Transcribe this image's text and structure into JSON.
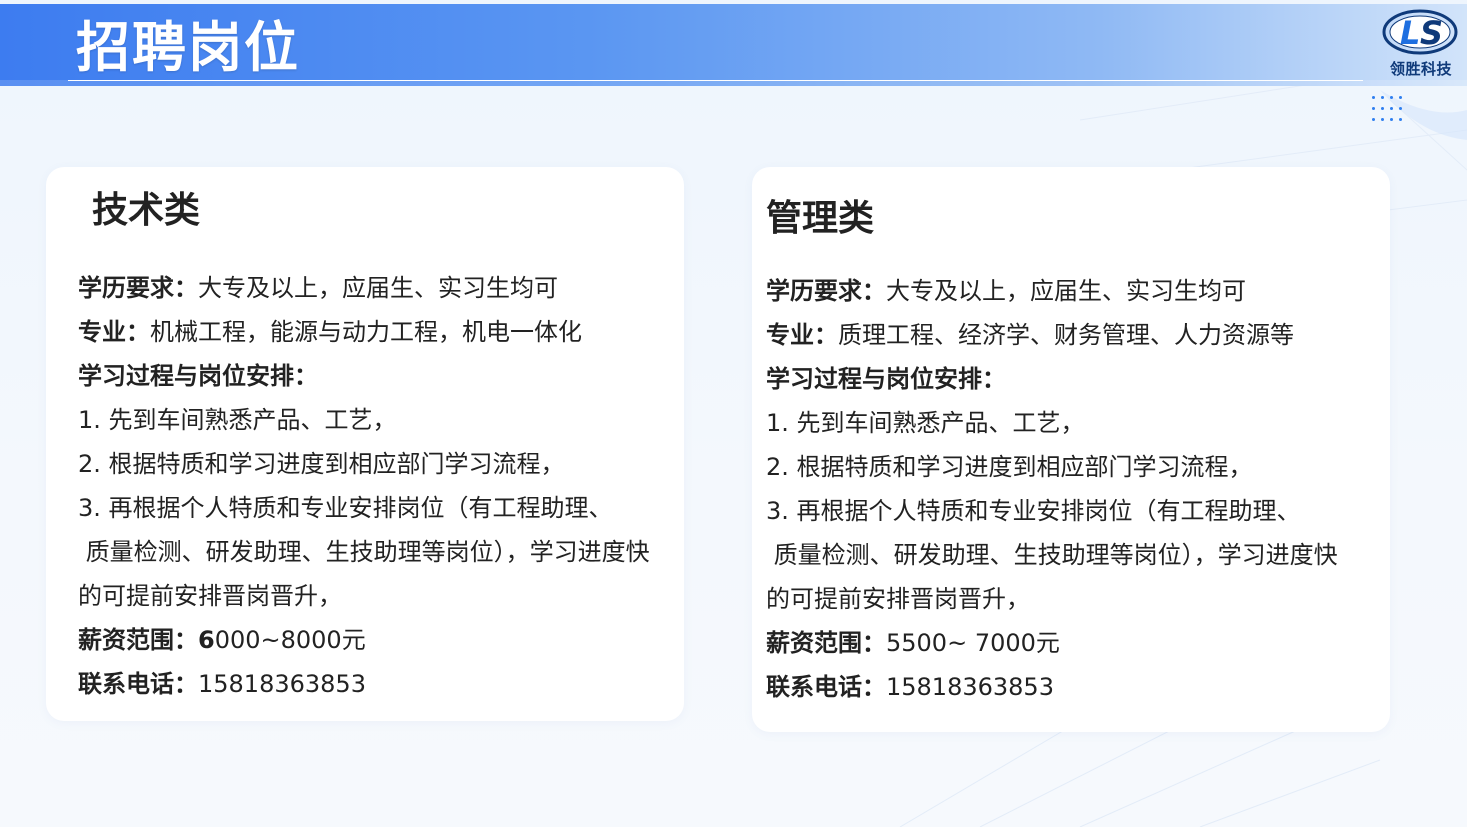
{
  "header": {
    "title": "招聘岗位",
    "logo_text": "领胜科技",
    "logo_icon": "ls-logo-icon"
  },
  "cards": [
    {
      "title": "技术类",
      "education_label": "学历要求：",
      "education_value": "大专及以上，应届生、实习生均可",
      "major_label": "专业：",
      "major_value": "机械工程，能源与动力工程，机电一体化",
      "process_label": "学习过程与岗位安排：",
      "step1": "1. 先到车间熟悉产品、工艺，",
      "step2": "2. 根据特质和学习进度到相应部门学习流程，",
      "step3_line1": "3. 再根据个人特质和专业安排岗位（有工程助理、",
      "step3_line2": " 质量检测、研发助理、生技助理等岗位），学习进度快",
      "step3_line3": "的可提前安排晋岗晋升，",
      "salary_label": "薪资范围：",
      "salary_value_bold": "6",
      "salary_value": "000~8000元",
      "phone_label": "联系电话：",
      "phone_value": "15818363853"
    },
    {
      "title": "管理类",
      "education_label": "学历要求：",
      "education_value": "大专及以上，应届生、实习生均可",
      "major_label": "专业：",
      "major_value": "质理工程、经济学、财务管理、人力资源等",
      "process_label": "学习过程与岗位安排：",
      "step1": "1. 先到车间熟悉产品、工艺，",
      "step2": "2. 根据特质和学习进度到相应部门学习流程，",
      "step3_line1": "3. 再根据个人特质和专业安排岗位（有工程助理、",
      "step3_line2": " 质量检测、研发助理、生技助理等岗位），学习进度快",
      "step3_line3": "的可提前安排晋岗晋升，",
      "salary_label": "薪资范围：",
      "salary_value": "5500~ 7000元",
      "phone_label": "联系电话：",
      "phone_value": "15818363853"
    }
  ],
  "colors": {
    "header_start": "#3d7cf0",
    "header_end": "#d2e4fa",
    "logo_blue": "#0f3a7a",
    "dot_blue": "#2f7ff0"
  }
}
